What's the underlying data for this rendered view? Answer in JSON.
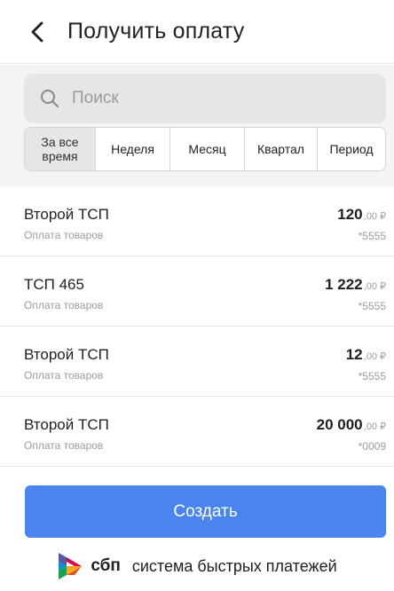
{
  "header": {
    "title": "Получить оплату",
    "back_icon": "chevron-left-icon"
  },
  "search": {
    "placeholder": "Поиск",
    "value": "",
    "icon": "search-icon"
  },
  "tabs": [
    {
      "label": "За все\nвремя",
      "active": true
    },
    {
      "label": "Неделя",
      "active": false
    },
    {
      "label": "Месяц",
      "active": false
    },
    {
      "label": "Квартал",
      "active": false
    },
    {
      "label": "Период",
      "active": false
    }
  ],
  "payments": [
    {
      "name": "Второй ТСП",
      "description": "Оплата товаров",
      "amount_main": "120",
      "amount_cents": ",00 ₽",
      "card": "*5555"
    },
    {
      "name": "ТСП 465",
      "description": "Оплата товаров",
      "amount_main": "1 222",
      "amount_cents": ",00 ₽",
      "card": "*5555"
    },
    {
      "name": "Второй ТСП",
      "description": "Оплата товаров",
      "amount_main": "12",
      "amount_cents": ",00 ₽",
      "card": "*5555"
    },
    {
      "name": "Второй ТСП",
      "description": "Оплата товаров",
      "amount_main": "20 000",
      "amount_cents": ",00 ₽",
      "card": "*0009"
    }
  ],
  "create_button": {
    "label": "Создать"
  },
  "sbp": {
    "brand": "сбп",
    "text": "система быстрых платежей",
    "logo": "sbp-logo-icon"
  },
  "colors": {
    "accent": "#4a84ee",
    "background": "#ffffff",
    "search_bg": "#e6e6e6",
    "muted_text": "#9c9c9c"
  }
}
